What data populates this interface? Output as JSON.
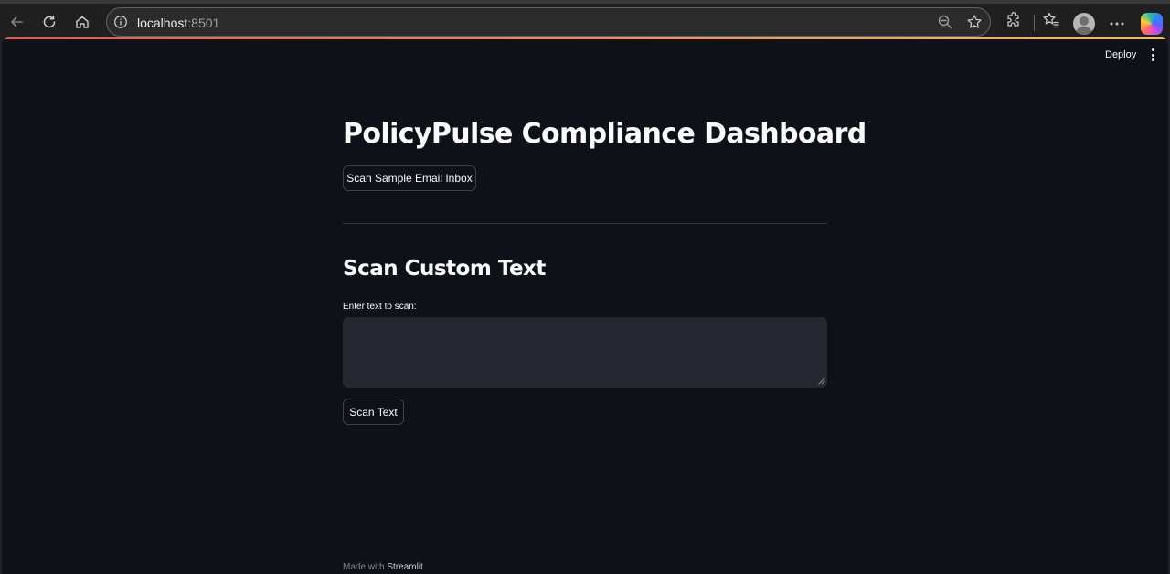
{
  "browser": {
    "url_host": "localhost",
    "url_port": ":8501"
  },
  "app": {
    "toolbar": {
      "deploy_label": "Deploy"
    },
    "title": "PolicyPulse Compliance Dashboard",
    "scan_inbox_button": "Scan Sample Email Inbox",
    "section_title": "Scan Custom Text",
    "textarea_label": "Enter text to scan:",
    "textarea_value": "",
    "scan_text_button": "Scan Text",
    "footer_prefix": "Made with ",
    "footer_brand": "Streamlit"
  },
  "colors": {
    "background": "#0e1117",
    "text": "#fafafa",
    "input_bg": "#262730",
    "accent_gradient": [
      "#ff4b4b",
      "#ffbd45"
    ]
  }
}
